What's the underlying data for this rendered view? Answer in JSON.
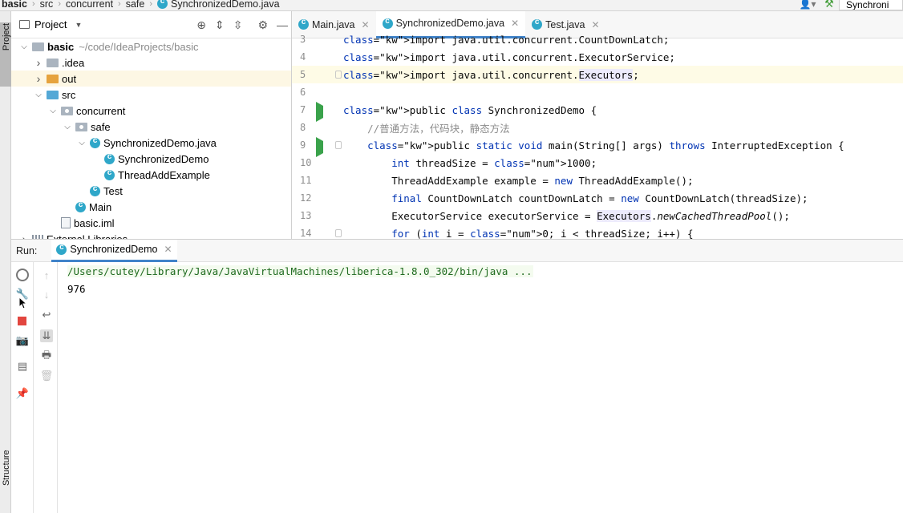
{
  "breadcrumb": [
    "basic",
    "src",
    "concurrent",
    "safe",
    "SynchronizedDemo.java"
  ],
  "toolbar": {
    "run_config_label": "Synchroni"
  },
  "left_strip": {
    "project_label": "Project",
    "structure_label": "Structure"
  },
  "project_panel": {
    "title": "Project",
    "tree": [
      {
        "label": "basic",
        "extra": "~/code/IdeaProjects/basic",
        "level": 0,
        "icon": "folder-gray-icon",
        "expanded": true,
        "bold": true
      },
      {
        "label": ".idea",
        "level": 1,
        "icon": "folder-gray-icon",
        "expanded": false
      },
      {
        "label": "out",
        "level": 1,
        "icon": "folder-orange-icon",
        "expanded": false,
        "selected": true
      },
      {
        "label": "src",
        "level": 1,
        "icon": "folder-blue-icon",
        "expanded": true
      },
      {
        "label": "concurrent",
        "level": 2,
        "icon": "package-icon",
        "expanded": true
      },
      {
        "label": "safe",
        "level": 3,
        "icon": "package-icon",
        "expanded": true
      },
      {
        "label": "SynchronizedDemo.java",
        "level": 4,
        "icon": "java-class-icon",
        "expanded": true
      },
      {
        "label": "SynchronizedDemo",
        "level": 5,
        "icon": "java-class-icon"
      },
      {
        "label": "ThreadAddExample",
        "level": 5,
        "icon": "java-class-icon"
      },
      {
        "label": "Test",
        "level": 4,
        "icon": "java-class-icon"
      },
      {
        "label": "Main",
        "level": 3,
        "icon": "java-class-icon"
      },
      {
        "label": "basic.iml",
        "level": 2,
        "icon": "file-icon"
      },
      {
        "label": "External Libraries",
        "level": 0,
        "icon": "library-icon",
        "expanded": false
      }
    ]
  },
  "editor": {
    "tabs": [
      {
        "label": "Main.java",
        "active": false
      },
      {
        "label": "SynchronizedDemo.java",
        "active": true
      },
      {
        "label": "Test.java",
        "active": false
      }
    ],
    "lines": [
      {
        "n": "3",
        "text": "import java.util.concurrent.CountDownLatch;"
      },
      {
        "n": "4",
        "text": "import java.util.concurrent.ExecutorService;"
      },
      {
        "n": "5",
        "text": "import java.util.concurrent.Executors;"
      },
      {
        "n": "6",
        "text": ""
      },
      {
        "n": "7",
        "text": "public class SynchronizedDemo {"
      },
      {
        "n": "8",
        "text": "    //普通方法，代码块，静态方法"
      },
      {
        "n": "9",
        "text": "    public static void main(String[] args) throws InterruptedException {"
      },
      {
        "n": "10",
        "text": "        int threadSize = 1000;"
      },
      {
        "n": "11",
        "text": "        ThreadAddExample example = new ThreadAddExample();"
      },
      {
        "n": "12",
        "text": "        final CountDownLatch countDownLatch = new CountDownLatch(threadSize);"
      },
      {
        "n": "13",
        "text": "        ExecutorService executorService = Executors.newCachedThreadPool();"
      },
      {
        "n": "14",
        "text": "        for (int i = 0; i < threadSize; i++) {"
      }
    ]
  },
  "run_panel": {
    "label": "Run:",
    "tab_label": "SynchronizedDemo",
    "output": [
      "/Users/cutey/Library/Java/JavaVirtualMachines/liberica-1.8.0_302/bin/java ...",
      "976"
    ]
  }
}
